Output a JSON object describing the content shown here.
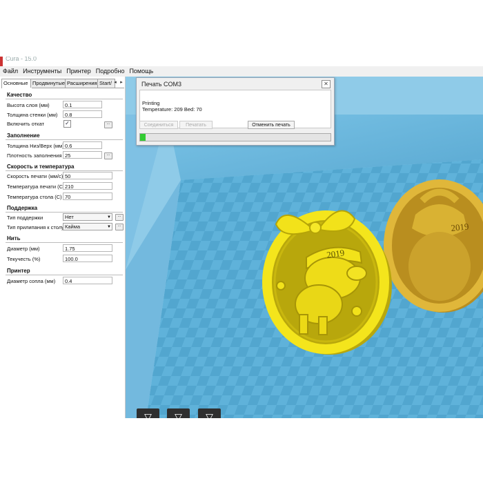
{
  "window": {
    "title": "Cura - 15.0"
  },
  "menu": [
    "Файл",
    "Инструменты",
    "Принтер",
    "Подробно",
    "Помощь"
  ],
  "tabs": [
    "Основные",
    "Продвинутые",
    "Расширения",
    "Start/"
  ],
  "tab_arrows": [
    "◂",
    "▸"
  ],
  "sections": {
    "quality": {
      "title": "Качество",
      "layer_height": {
        "label": "Высота слоя (мм)",
        "value": "0.1"
      },
      "wall_thickness": {
        "label": "Толщина стенки (мм)",
        "value": "0.8"
      },
      "retraction": {
        "label": "Включить откат",
        "checked": "✓"
      }
    },
    "fill": {
      "title": "Заполнение",
      "top_bottom": {
        "label": "Толщина Низ/Верх (мм)",
        "value": "0.6"
      },
      "density": {
        "label": "Плотность заполнения",
        "value": "25"
      }
    },
    "speed": {
      "title": "Скорость и температура",
      "print_speed": {
        "label": "Скорость печати (мм/с)",
        "value": "50"
      },
      "print_temp": {
        "label": "Температура печати (C)",
        "value": "210"
      },
      "bed_temp": {
        "label": "Температура стола (C)",
        "value": "70"
      }
    },
    "support": {
      "title": "Поддержка",
      "support_type": {
        "label": "Тип поддержки",
        "value": "Нет"
      },
      "adhesion": {
        "label": "Тип прилипания к столу",
        "value": "Кайма"
      }
    },
    "filament": {
      "title": "Нить",
      "diameter": {
        "label": "Диаметр (мм)",
        "value": "1.75"
      },
      "flow": {
        "label": "Текучесть (%)",
        "value": "100.0"
      }
    },
    "machine": {
      "title": "Принтер",
      "nozzle": {
        "label": "Диаметр сопла (мм)",
        "value": "0.4"
      }
    }
  },
  "dots_label": "...",
  "dialog": {
    "title": "Печать COM3",
    "close": "✕",
    "status_line1": "Printing",
    "status_line2": "Temperature: 209 Bed: 70",
    "connect_label": "Соединиться",
    "print_label": "Печатать",
    "cancel_label": "Отменить печать",
    "progress": 0.03
  },
  "models": [
    {
      "year": "2019"
    },
    {
      "year": "2019"
    }
  ],
  "colors": {
    "bed": "#5aaed6",
    "model": "#f2e21a",
    "model2": "#d9b233",
    "progress": "#33cc33"
  }
}
